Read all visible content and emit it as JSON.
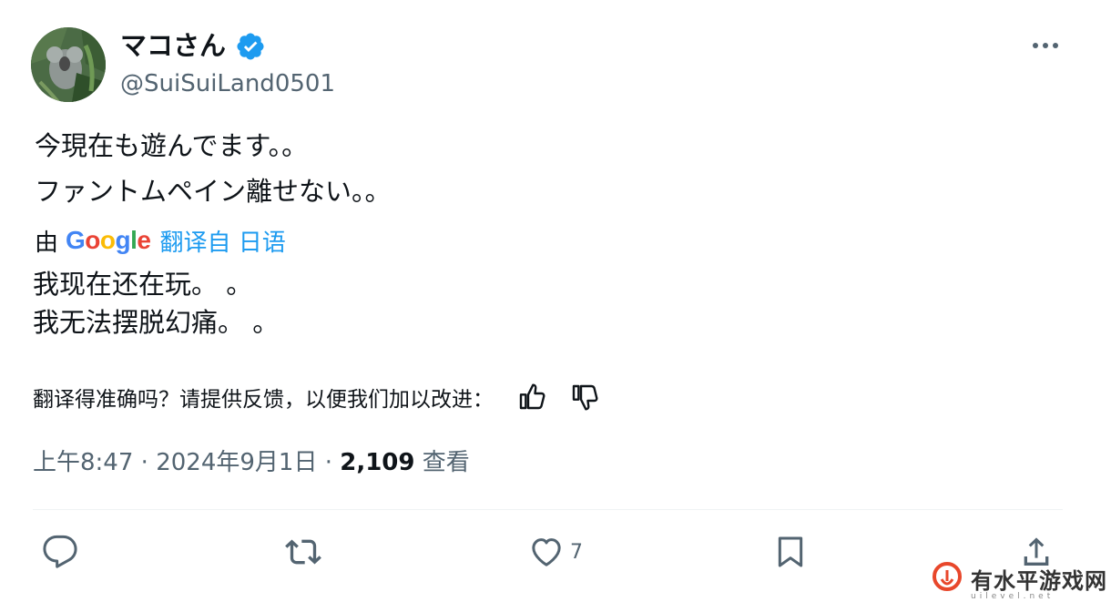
{
  "author": {
    "display_name": "マコさん",
    "handle": "@SuiSuiLand0501",
    "verified": true
  },
  "tweet": {
    "original_lines": [
      "今現在も遊んでます。。",
      "ファントムペイン離せない。。"
    ],
    "translation_prefix": "由",
    "translation_provider": "Google",
    "translation_link": "翻译自 日语",
    "translated_lines": [
      "我现在还在玩。 。",
      "我无法摆脱幻痛。 。"
    ],
    "feedback_prompt": "翻译得准确吗？请提供反馈，以便我们加以改进："
  },
  "meta": {
    "time": "上午8:47",
    "separator": "·",
    "date": "2024年9月1日",
    "views_count": "2,109",
    "views_label": "查看"
  },
  "actions": {
    "like_count": "7"
  },
  "watermark": {
    "text": "有水平游戏网",
    "sub": "uilevel.net"
  },
  "colors": {
    "accent": "#1d9bf0",
    "secondary_text": "#536471",
    "primary_text": "#0f1419",
    "divider": "#eff3f4"
  },
  "icons": {
    "verified": "verified-badge-icon",
    "more": "more-horizontal-icon",
    "reply": "reply-icon",
    "retweet": "retweet-icon",
    "like": "heart-icon",
    "bookmark": "bookmark-icon",
    "share": "share-icon",
    "thumbs_up": "thumbs-up-icon",
    "thumbs_down": "thumbs-down-icon"
  }
}
